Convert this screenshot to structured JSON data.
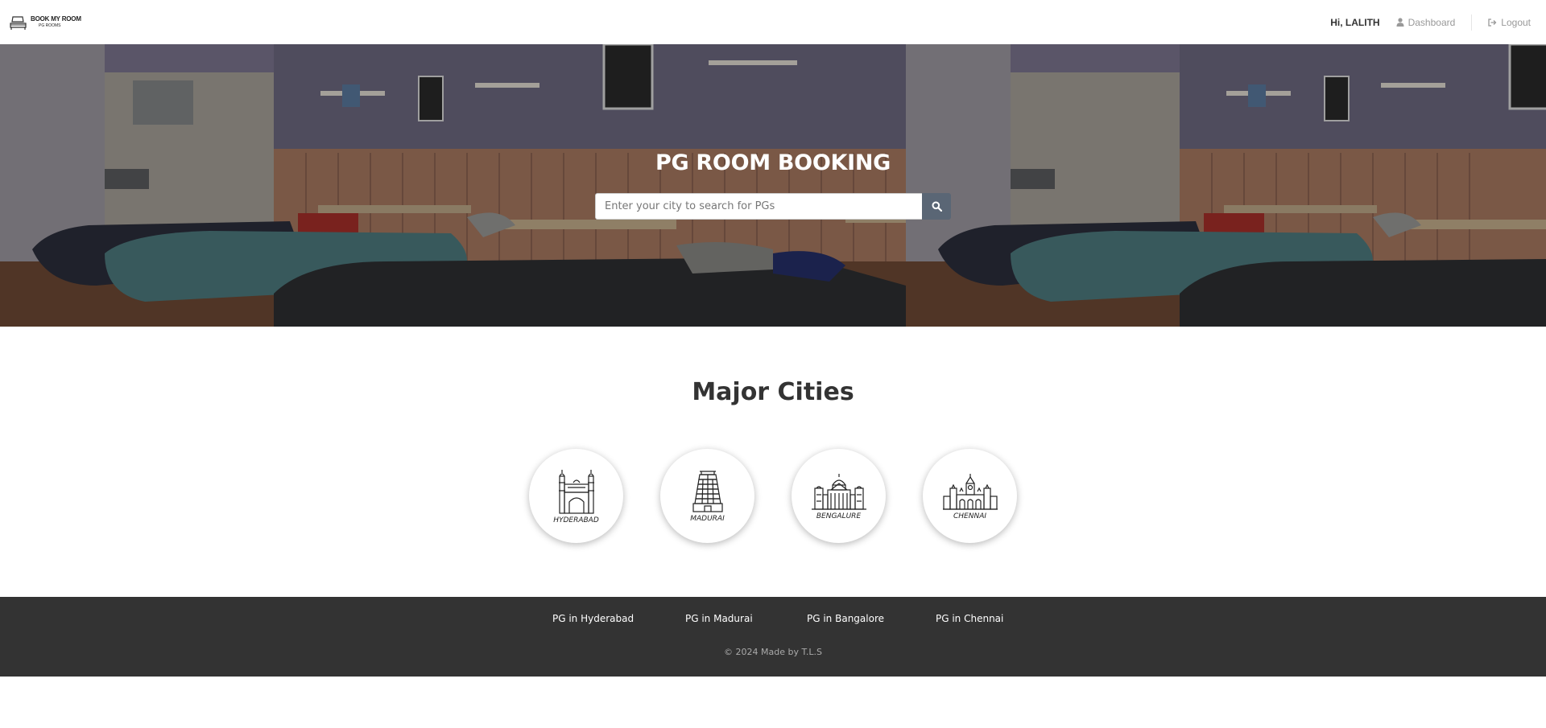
{
  "header": {
    "logo_main": "BOOK MY ROOM",
    "logo_sub": "PG ROOMS",
    "greeting": "Hi, LALITH",
    "dashboard_label": "Dashboard",
    "logout_label": "Logout",
    "icons": {
      "dashboard": "user-icon",
      "logout": "sign-out-icon"
    }
  },
  "hero": {
    "title": "PG ROOM BOOKING",
    "search_placeholder": "Enter your city to search for PGs",
    "search_icon": "search-icon"
  },
  "cities": {
    "title": "Major Cities",
    "items": [
      {
        "label": "HYDERABAD",
        "icon": "charminar-icon"
      },
      {
        "label": "MADURAI",
        "icon": "temple-gopuram-icon"
      },
      {
        "label": "BENGALURE",
        "icon": "vidhana-soudha-icon"
      },
      {
        "label": "CHENNAI",
        "icon": "central-station-icon"
      }
    ]
  },
  "footer": {
    "links": [
      "PG in Hyderabad",
      "PG in Madurai",
      "PG in Bangalore",
      "PG in Chennai"
    ],
    "copyright": "© 2024 Made by T.L.S"
  },
  "colors": {
    "footer_bg": "#333333",
    "search_button": "#5a6675",
    "hero_title": "#ffffff"
  }
}
